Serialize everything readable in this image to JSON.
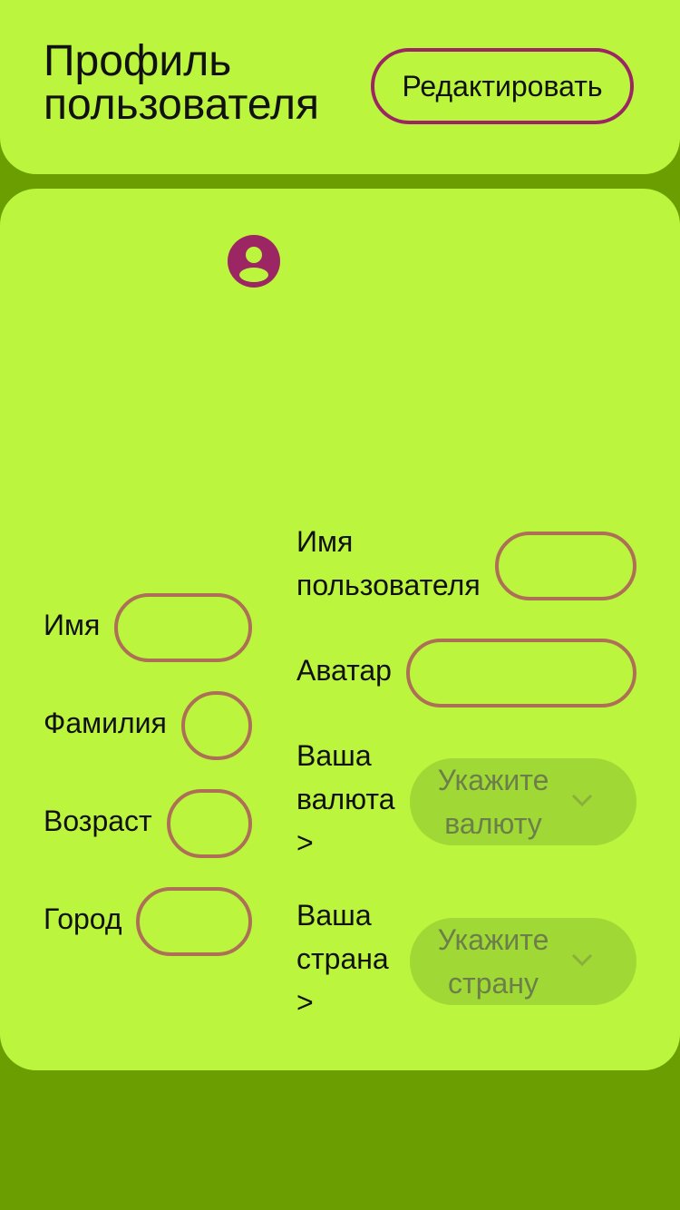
{
  "header": {
    "title": "Профиль пользователя",
    "edit_label": "Редактировать"
  },
  "profile": {
    "avatar_icon": "user-avatar-icon",
    "left_fields": [
      {
        "label": "Имя",
        "value": ""
      },
      {
        "label": "Фамилия",
        "value": ""
      },
      {
        "label": "Возраст",
        "value": ""
      },
      {
        "label": "Город",
        "value": ""
      }
    ],
    "right_fields": [
      {
        "label": "Имя пользователя",
        "value": ""
      },
      {
        "label": "Аватар",
        "value": ""
      }
    ],
    "currency": {
      "label": "Ваша валюта >",
      "placeholder": "Укажите валюту"
    },
    "country": {
      "label": "Ваша страна >",
      "placeholder": "Укажите страну"
    }
  },
  "colors": {
    "background": "#6b9e00",
    "card": "#bbf53d",
    "accent": "#9c2564",
    "field_border": "#ad6f56",
    "select_bg": "#a0d835"
  }
}
